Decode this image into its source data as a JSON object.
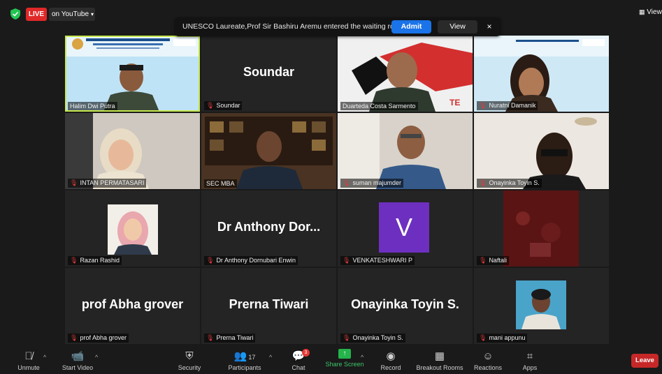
{
  "top": {
    "live_badge": "LIVE",
    "youtube_label": "on YouTube"
  },
  "banner": {
    "text": "UNESCO Laureate,Prof Sir Bashiru Aremu entered the waiting room",
    "admit_label": "Admit",
    "view_label": "View",
    "close_glyph": "×"
  },
  "view_toggle": {
    "label": "View"
  },
  "participants": [
    {
      "label": "Halim Dwi Putra",
      "video": true,
      "active": true,
      "muted": false
    },
    {
      "label": "Soundar",
      "big_name": "Soundar",
      "video": false,
      "muted": true
    },
    {
      "label": "Duarteda Costa Sarmento",
      "video": true,
      "muted": false
    },
    {
      "label": "Nuratni Damanik",
      "video": true,
      "muted": true
    },
    {
      "label": "INTAN PERMATASARI",
      "video": true,
      "muted": true
    },
    {
      "label": "SEC MBA",
      "video": true,
      "muted": false
    },
    {
      "label": "suman majumder",
      "video": true,
      "muted": true
    },
    {
      "label": "Onayinka Toyin S.",
      "video": true,
      "muted": true
    },
    {
      "label": "Razan Rashid",
      "video": false,
      "photo": true,
      "muted": true
    },
    {
      "label": "Dr Anthony Dornubari Enwin",
      "big_name": "Dr Anthony Dor...",
      "video": false,
      "muted": true
    },
    {
      "label": "VENKATESHWARI P",
      "avatar_letter": "V",
      "video": false,
      "muted": true
    },
    {
      "label": "Naftali",
      "video": true,
      "muted": true
    },
    {
      "label": "prof Abha grover",
      "big_name": "prof Abha grover",
      "video": false,
      "muted": true
    },
    {
      "label": "Prerna Tiwari",
      "big_name": "Prerna Tiwari",
      "video": false,
      "muted": true
    },
    {
      "label": "Onayinka Toyin S.",
      "big_name": "Onayinka Toyin S.",
      "video": false,
      "muted": true
    },
    {
      "label": "mani appunu",
      "video": false,
      "photo": true,
      "muted": true
    }
  ],
  "toolbar": {
    "unmute": "Unmute",
    "start_video": "Start Video",
    "security": "Security",
    "participants": "Participants",
    "participants_count": "17",
    "chat": "Chat",
    "chat_badge": "3",
    "share_screen": "Share Screen",
    "record": "Record",
    "breakout_rooms": "Breakout Rooms",
    "reactions": "Reactions",
    "apps": "Apps",
    "leave": "Leave"
  },
  "colors": {
    "live_red": "#e02828",
    "admit_blue": "#1a73e8",
    "active_speaker": "#c6e84e",
    "share_green": "#25b34b",
    "leave_red": "#c62828",
    "avatar_purple": "#6d2fc0"
  }
}
